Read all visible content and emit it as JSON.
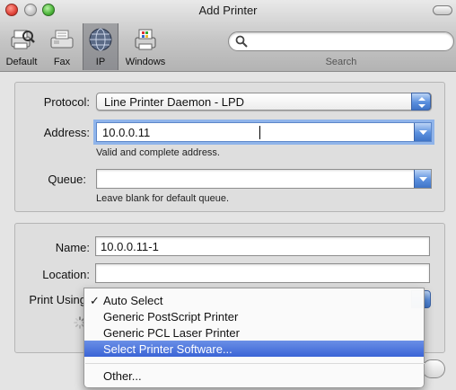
{
  "window": {
    "title": "Add Printer"
  },
  "toolbar": {
    "items": [
      {
        "label": "Default",
        "icon": "default-printer-icon"
      },
      {
        "label": "Fax",
        "icon": "fax-icon"
      },
      {
        "label": "IP",
        "icon": "ip-globe-icon",
        "selected": true
      },
      {
        "label": "Windows",
        "icon": "windows-printer-icon"
      }
    ],
    "search": {
      "placeholder": "",
      "label": "Search"
    }
  },
  "connection": {
    "protocol": {
      "label": "Protocol:",
      "value": "Line Printer Daemon - LPD"
    },
    "address": {
      "label": "Address:",
      "value": "10.0.0.11",
      "hint": "Valid and complete address."
    },
    "queue": {
      "label": "Queue:",
      "value": "",
      "hint": "Leave blank for default queue."
    }
  },
  "details": {
    "name": {
      "label": "Name:",
      "value": "10.0.0.11-1"
    },
    "location": {
      "label": "Location:",
      "value": ""
    },
    "print_using": {
      "label": "Print Using"
    }
  },
  "menu": {
    "checkmark": "✓",
    "items": [
      {
        "label": "Auto Select",
        "checked": true
      },
      {
        "label": "Generic PostScript Printer"
      },
      {
        "label": "Generic PCL Laser Printer"
      },
      {
        "label": "Select Printer Software...",
        "highlighted": true
      },
      {
        "label": "Other..."
      }
    ]
  },
  "colors": {
    "accent": "#3a64d6",
    "focus_ring": "#8fb4ea",
    "close": "#e0443a",
    "zoom": "#4cb43a"
  }
}
